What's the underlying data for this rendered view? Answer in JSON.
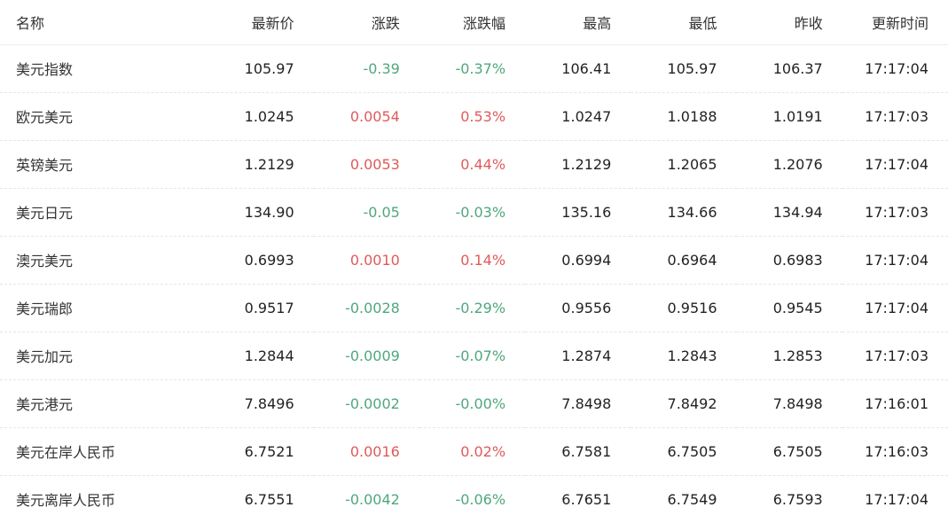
{
  "colors": {
    "up": "#e05a5a",
    "down": "#4fa77d",
    "text": "#222222"
  },
  "headers": {
    "name": "名称",
    "latest": "最新价",
    "change": "涨跌",
    "change_pct": "涨跌幅",
    "high": "最高",
    "low": "最低",
    "prev_close": "昨收",
    "update_time": "更新时间"
  },
  "rows": [
    {
      "name": "美元指数",
      "latest": "105.97",
      "change": "-0.39",
      "change_pct": "-0.37%",
      "high": "106.41",
      "low": "105.97",
      "prev_close": "106.37",
      "update_time": "17:17:04",
      "direction": "down"
    },
    {
      "name": "欧元美元",
      "latest": "1.0245",
      "change": "0.0054",
      "change_pct": "0.53%",
      "high": "1.0247",
      "low": "1.0188",
      "prev_close": "1.0191",
      "update_time": "17:17:03",
      "direction": "up"
    },
    {
      "name": "英镑美元",
      "latest": "1.2129",
      "change": "0.0053",
      "change_pct": "0.44%",
      "high": "1.2129",
      "low": "1.2065",
      "prev_close": "1.2076",
      "update_time": "17:17:04",
      "direction": "up"
    },
    {
      "name": "美元日元",
      "latest": "134.90",
      "change": "-0.05",
      "change_pct": "-0.03%",
      "high": "135.16",
      "low": "134.66",
      "prev_close": "134.94",
      "update_time": "17:17:03",
      "direction": "down"
    },
    {
      "name": "澳元美元",
      "latest": "0.6993",
      "change": "0.0010",
      "change_pct": "0.14%",
      "high": "0.6994",
      "low": "0.6964",
      "prev_close": "0.6983",
      "update_time": "17:17:04",
      "direction": "up"
    },
    {
      "name": "美元瑞郎",
      "latest": "0.9517",
      "change": "-0.0028",
      "change_pct": "-0.29%",
      "high": "0.9556",
      "low": "0.9516",
      "prev_close": "0.9545",
      "update_time": "17:17:04",
      "direction": "down"
    },
    {
      "name": "美元加元",
      "latest": "1.2844",
      "change": "-0.0009",
      "change_pct": "-0.07%",
      "high": "1.2874",
      "low": "1.2843",
      "prev_close": "1.2853",
      "update_time": "17:17:03",
      "direction": "down"
    },
    {
      "name": "美元港元",
      "latest": "7.8496",
      "change": "-0.0002",
      "change_pct": "-0.00%",
      "high": "7.8498",
      "low": "7.8492",
      "prev_close": "7.8498",
      "update_time": "17:16:01",
      "direction": "down"
    },
    {
      "name": "美元在岸人民币",
      "latest": "6.7521",
      "change": "0.0016",
      "change_pct": "0.02%",
      "high": "6.7581",
      "low": "6.7505",
      "prev_close": "6.7505",
      "update_time": "17:16:03",
      "direction": "up"
    },
    {
      "name": "美元离岸人民币",
      "latest": "6.7551",
      "change": "-0.0042",
      "change_pct": "-0.06%",
      "high": "6.7651",
      "low": "6.7549",
      "prev_close": "6.7593",
      "update_time": "17:17:04",
      "direction": "down"
    }
  ]
}
